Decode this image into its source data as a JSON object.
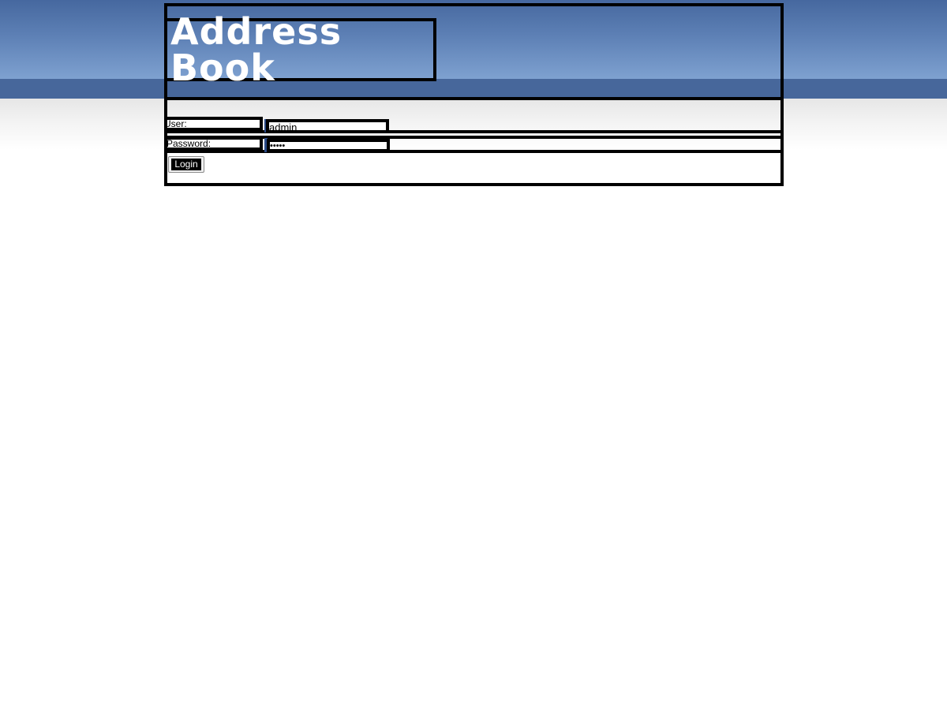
{
  "header": {
    "logo_text": "Address Book"
  },
  "login_form": {
    "user_label": "User:",
    "user_value": "admin",
    "password_label": "Password:",
    "password_value": "•••••",
    "login_button": "Login"
  },
  "colors": {
    "header_top": "#46689f",
    "header_bottom": "#7ea1d0",
    "nav_band": "#47679b"
  }
}
